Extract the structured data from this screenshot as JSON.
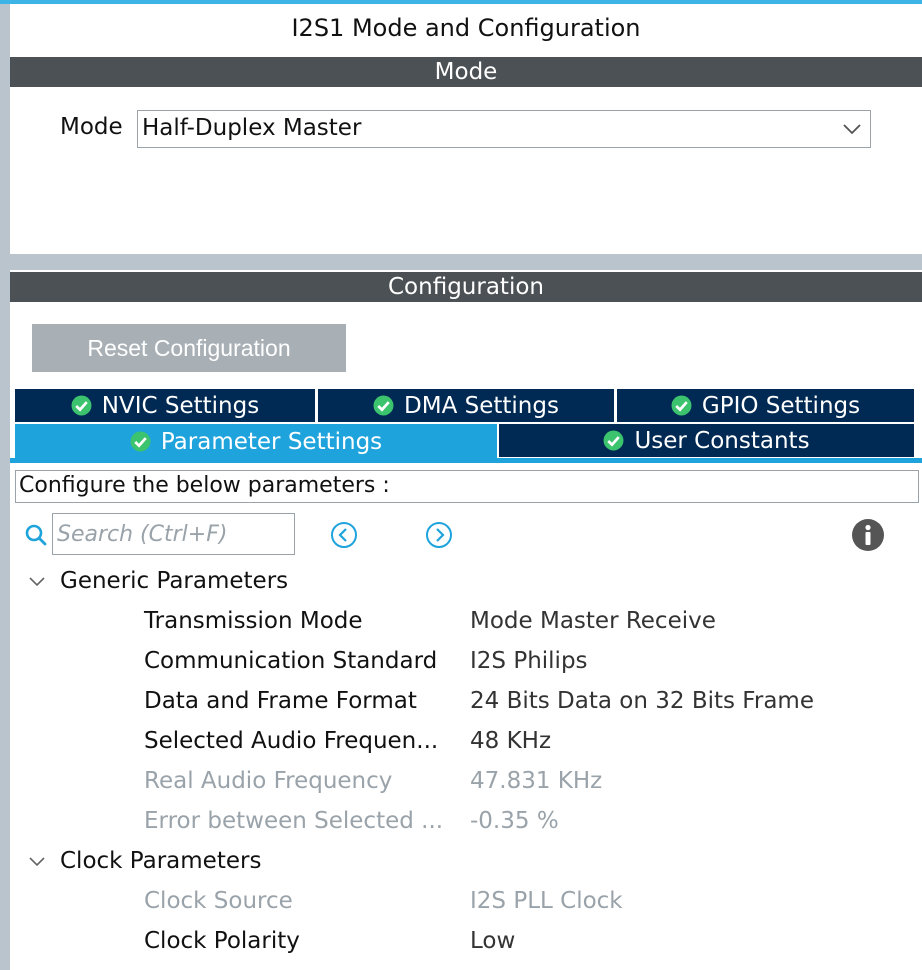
{
  "window": {
    "title": "I2S1 Mode and Configuration"
  },
  "mode_section": {
    "header": "Mode",
    "mode_label": "Mode",
    "mode_value": "Half-Duplex Master"
  },
  "config_section": {
    "header": "Configuration",
    "reset_label": "Reset Configuration",
    "tabs": [
      {
        "label": "NVIC Settings",
        "active": false
      },
      {
        "label": "DMA Settings",
        "active": false
      },
      {
        "label": "GPIO Settings",
        "active": false
      },
      {
        "label": "Parameter Settings",
        "active": true
      },
      {
        "label": "User Constants",
        "active": false
      }
    ],
    "instructions": "Configure the below parameters :",
    "search_placeholder": "Search (Ctrl+F)"
  },
  "groups": [
    {
      "title": "Generic Parameters",
      "expanded": true,
      "rows": [
        {
          "name": "Transmission Mode",
          "value": "Mode Master Receive",
          "enabled": true
        },
        {
          "name": "Communication Standard",
          "value": "I2S Philips",
          "enabled": true
        },
        {
          "name": "Data and Frame Format",
          "value": "24 Bits Data on 32 Bits Frame",
          "enabled": true
        },
        {
          "name": "Selected Audio Frequen...",
          "value": "48 KHz",
          "enabled": true
        },
        {
          "name": "Real Audio Frequency",
          "value": "47.831 KHz",
          "enabled": false
        },
        {
          "name": "Error between Selected ...",
          "value": "-0.35 %",
          "enabled": false
        }
      ]
    },
    {
      "title": "Clock Parameters",
      "expanded": true,
      "rows": [
        {
          "name": "Clock Source",
          "value": "I2S PLL Clock",
          "enabled": false
        },
        {
          "name": "Clock Polarity",
          "value": "Low",
          "enabled": true
        }
      ]
    }
  ],
  "colors": {
    "accent": "#1fa3dc",
    "tab_dark": "#002a53",
    "section_bar": "#4b5155",
    "check_green": "#3cc36e",
    "disabled_text": "#9aa3aa"
  }
}
